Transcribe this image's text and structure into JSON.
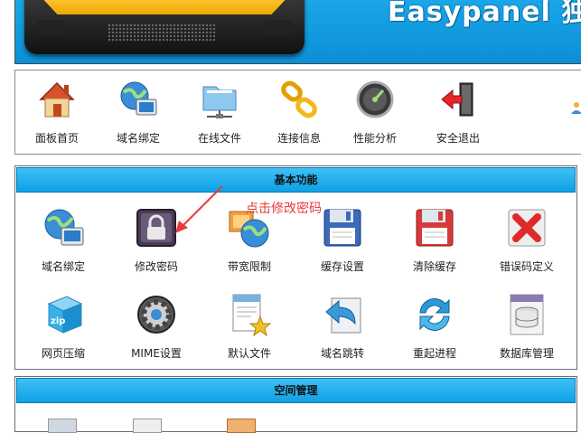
{
  "header": {
    "brand": "Easypanel 独"
  },
  "toolbar": {
    "items": [
      {
        "label": "面板首页",
        "icon": "home-icon"
      },
      {
        "label": "域名绑定",
        "icon": "globe-monitor-icon"
      },
      {
        "label": "在线文件",
        "icon": "folder-network-icon"
      },
      {
        "label": "连接信息",
        "icon": "chain-link-icon"
      },
      {
        "label": "性能分析",
        "icon": "gauge-icon"
      },
      {
        "label": "安全退出",
        "icon": "exit-door-icon"
      }
    ]
  },
  "basic": {
    "title": "基本功能",
    "items": [
      {
        "label": "域名绑定",
        "icon": "globe-monitor-icon"
      },
      {
        "label": "修改密码",
        "icon": "padlock-icon"
      },
      {
        "label": "带宽限制",
        "icon": "bandwidth-globe-icon"
      },
      {
        "label": "缓存设置",
        "icon": "floppy-disk-icon"
      },
      {
        "label": "清除缓存",
        "icon": "floppy-disk-red-icon"
      },
      {
        "label": "错误码定义",
        "icon": "red-x-icon"
      },
      {
        "label": "网页压缩",
        "icon": "zip-box-icon"
      },
      {
        "label": "MIME设置",
        "icon": "gear-icon"
      },
      {
        "label": "默认文件",
        "icon": "document-star-icon"
      },
      {
        "label": "域名跳转",
        "icon": "redirect-arrow-icon"
      },
      {
        "label": "重起进程",
        "icon": "refresh-icon"
      },
      {
        "label": "数据库管理",
        "icon": "database-icon"
      }
    ]
  },
  "space": {
    "title": "空间管理"
  },
  "annotation": {
    "text": "点击修改密码",
    "color": "#e83a3a"
  }
}
